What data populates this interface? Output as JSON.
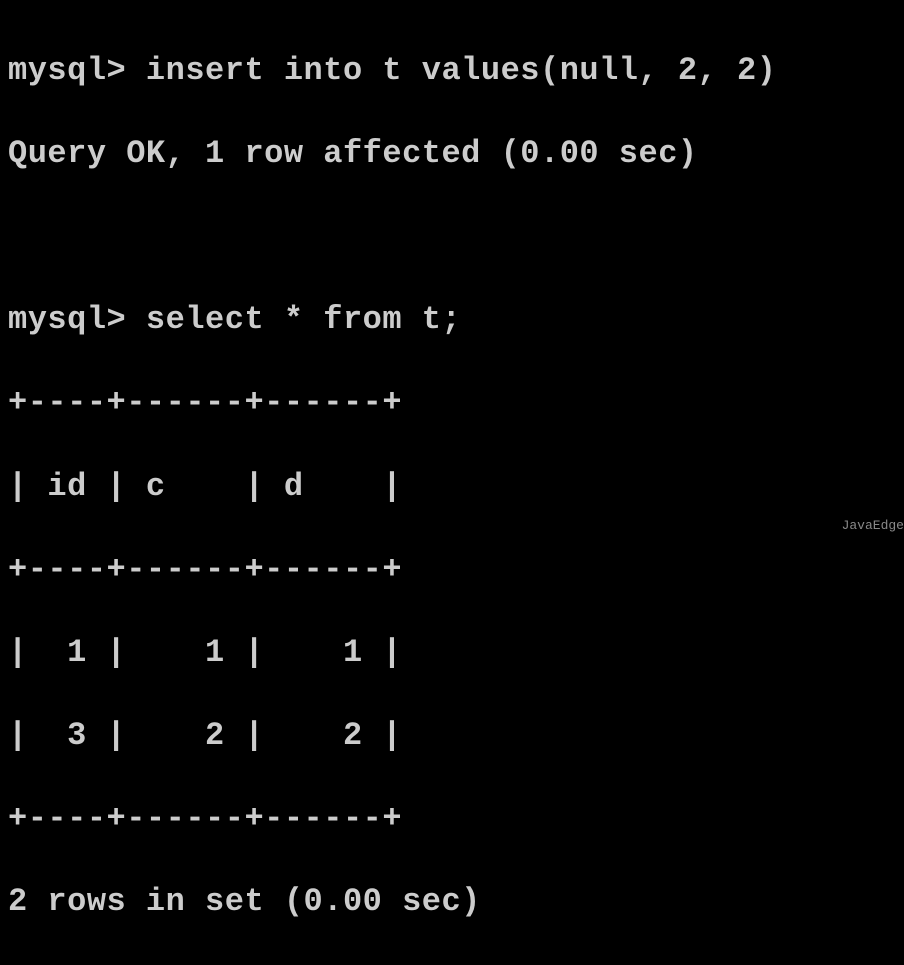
{
  "prompt_text": "mysql>",
  "commands": {
    "insert": "insert into t values(null, 2, 2)",
    "select": "select * from t;"
  },
  "responses": {
    "insert_ok": "Query OK, 1 row affected (0.00 sec)",
    "rows_in_set": "2 rows in set (0.00 sec)"
  },
  "table": {
    "border_top": "+----+------+------+",
    "header_row": "| id | c    | d    |",
    "border_mid": "+----+------+------+",
    "data_row_1": "|  1 |    1 |    1 |",
    "data_row_2": "|  3 |    2 |    2 |",
    "border_bot": "+----+------+------+"
  },
  "chart_data": {
    "type": "table",
    "columns": [
      "id",
      "c",
      "d"
    ],
    "rows": [
      [
        1,
        1,
        1
      ],
      [
        3,
        2,
        2
      ]
    ]
  },
  "watermark": "JavaEdge"
}
